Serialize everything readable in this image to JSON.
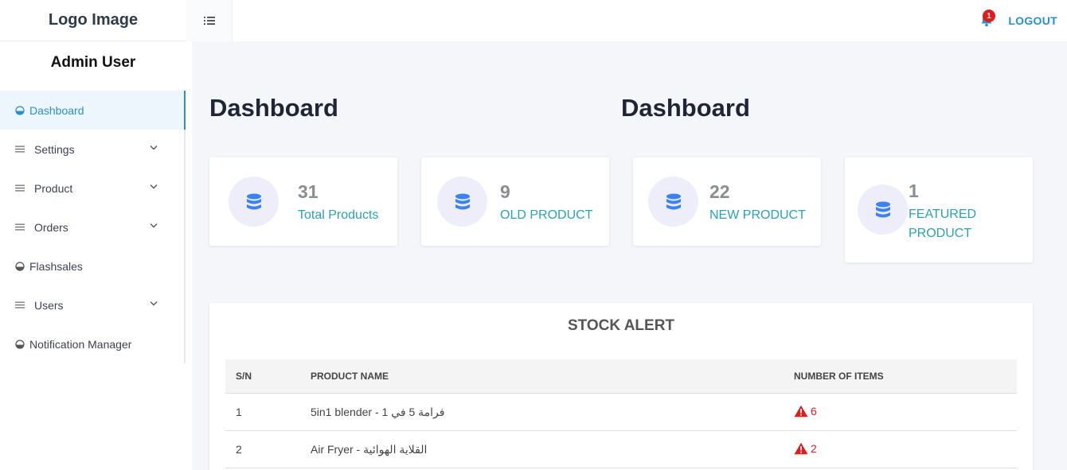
{
  "header": {
    "logo": "Logo Image",
    "notification_count": "1",
    "logout_label": "LOGOUT"
  },
  "sidebar": {
    "user_name": "Admin User",
    "items": [
      {
        "label": "Dashboard",
        "icon": "dashboard-icon",
        "expandable": false,
        "active": true
      },
      {
        "label": "Settings",
        "icon": "menu-lines-icon",
        "expandable": true
      },
      {
        "label": "Product",
        "icon": "menu-lines-icon",
        "expandable": true
      },
      {
        "label": "Orders",
        "icon": "menu-lines-icon",
        "expandable": true
      },
      {
        "label": "Flashsales",
        "icon": "dashboard-icon",
        "expandable": false
      },
      {
        "label": "Users",
        "icon": "menu-lines-icon",
        "expandable": true
      },
      {
        "label": "Notification Manager",
        "icon": "dashboard-icon",
        "expandable": false
      }
    ]
  },
  "main": {
    "title_left": "Dashboard",
    "title_right": "Dashboard",
    "stats": [
      {
        "value": "31",
        "label": "Total Products",
        "icon": "database-icon"
      },
      {
        "value": "9",
        "label": "OLD PRODUCT",
        "icon": "database-icon"
      },
      {
        "value": "22",
        "label": "NEW PRODUCT",
        "icon": "database-icon"
      },
      {
        "value": "1",
        "label": "FEATURED PRODUCT",
        "icon": "database-icon"
      }
    ],
    "stock_alert": {
      "title": "STOCK ALERT",
      "columns": [
        "S/N",
        "PRODUCT NAME",
        "NUMBER OF ITEMS"
      ],
      "rows": [
        {
          "sn": "1",
          "name": "5in1 blender - فرامة 5 في 1",
          "qty": "6"
        },
        {
          "sn": "2",
          "name": "Air Fryer - القلاية الهوائية",
          "qty": "2"
        }
      ]
    }
  },
  "colors": {
    "accent": "#2a8fd1",
    "stat_label": "#2aa1b8",
    "stat_icon": "#3b82f6",
    "alert": "#e21b1b"
  }
}
